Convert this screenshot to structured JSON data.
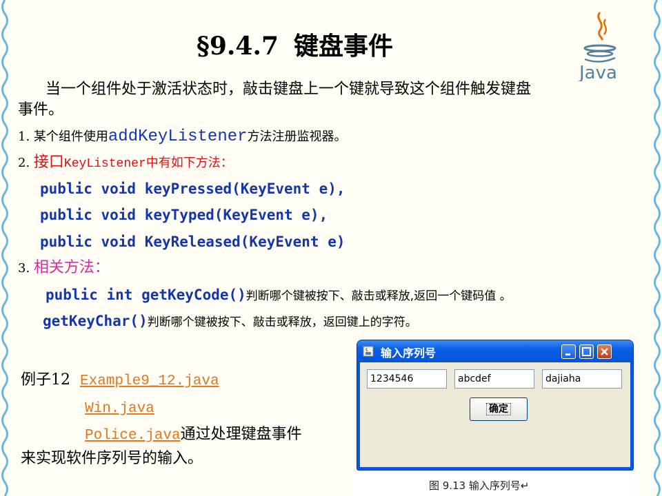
{
  "slide": {
    "title_num": "§9.4.7",
    "title_text": "键盘事件",
    "logo_text": "Java",
    "intro_line1": "当一个组件处于激活状态时，敲击键盘上一个键就导致这个组件触发键盘",
    "intro_line2": "事件。",
    "item1_prefix": "1. 某个组件使用",
    "item1_code": "addKeyListener",
    "item1_suffix": "方法注册监视器。",
    "item2_prefix": "2. ",
    "item2_red1": "接口",
    "item2_code": "KeyListener",
    "item2_red2": "中有如下方法：",
    "method1": "public void keyPressed(KeyEvent e),",
    "method2": "public void keyTyped(KeyEvent e),",
    "method3": "public void KeyReleased(KeyEvent e)",
    "item3_prefix": "3. ",
    "item3_label": "相关方法：",
    "getkeycode_code": "public int getKeyCode()",
    "getkeycode_desc": "判断哪个键被按下、敲击或释放,返回一个键码值 。",
    "getkeychar_code": "getKeyChar()",
    "getkeychar_desc": "判断哪个键被按下、敲击或释放，返回键上的字符。",
    "example_label": "例子12",
    "link1": "Example9_12.java",
    "link2": "Win.java",
    "link3": "Police.java",
    "link3_suffix": "通过处理键盘事件",
    "example_tail": "来实现软件序列号的输入。",
    "caption": "图 9.13    输入序列号↵"
  },
  "window": {
    "title": "输入序列号",
    "field1": "1234546",
    "field2": "abcdef",
    "field3": "dajiaha",
    "ok_label": "确定"
  },
  "colors": {
    "border": "#69b6e6",
    "code_blue": "#1436a8",
    "red": "#e01010",
    "magenta": "#d62ea6",
    "link": "#e07820"
  }
}
